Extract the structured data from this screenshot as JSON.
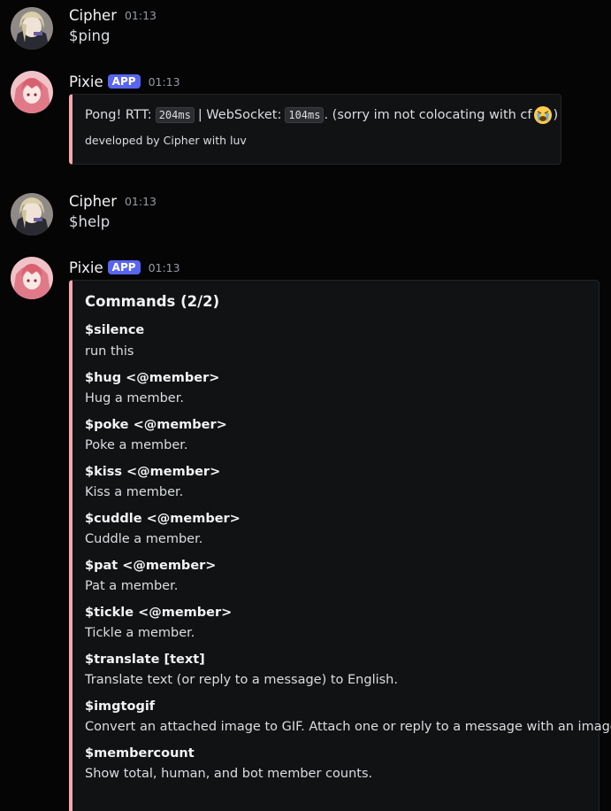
{
  "colors": {
    "background": "#050505",
    "embed_accent": "#f4a8b0",
    "app_badge": "#5865f2",
    "timestamp": "#949ba4"
  },
  "messages": [
    {
      "author": "Cipher",
      "timestamp": "01:13",
      "text": "$ping"
    },
    {
      "author": "Pixie",
      "badge": "APP",
      "timestamp": "01:13",
      "embed": {
        "pong_prefix": "Pong! RTT:",
        "rtt": "204ms",
        "websocket_prefix": "| WebSocket:",
        "websocket": "104ms",
        "suffix_before_emoji": ". (sorry im not colocating with cf",
        "emoji": "loudly-crying-face-icon",
        "suffix_after_emoji": ")",
        "footer": "developed by Cipher with luv"
      }
    },
    {
      "author": "Cipher",
      "timestamp": "01:13",
      "text": "$help"
    },
    {
      "author": "Pixie",
      "badge": "APP",
      "timestamp": "01:13",
      "embed": {
        "title": "Commands (2/2)",
        "fields": [
          {
            "name": "$silence",
            "value": "run this"
          },
          {
            "name": "$hug <@member>",
            "value": "Hug a member."
          },
          {
            "name": "$poke <@member>",
            "value": "Poke a member."
          },
          {
            "name": "$kiss <@member>",
            "value": "Kiss a member."
          },
          {
            "name": "$cuddle <@member>",
            "value": "Cuddle a member."
          },
          {
            "name": "$pat <@member>",
            "value": "Pat a member."
          },
          {
            "name": "$tickle <@member>",
            "value": "Tickle a member."
          },
          {
            "name": "$translate [text]",
            "value": "Translate text (or reply to a message) to English."
          },
          {
            "name": "$imgtogif",
            "value": "Convert an attached image to GIF. Attach one or reply to a message with an image."
          },
          {
            "name": "$membercount",
            "value": "Show total, human, and bot member counts."
          }
        ]
      }
    }
  ]
}
